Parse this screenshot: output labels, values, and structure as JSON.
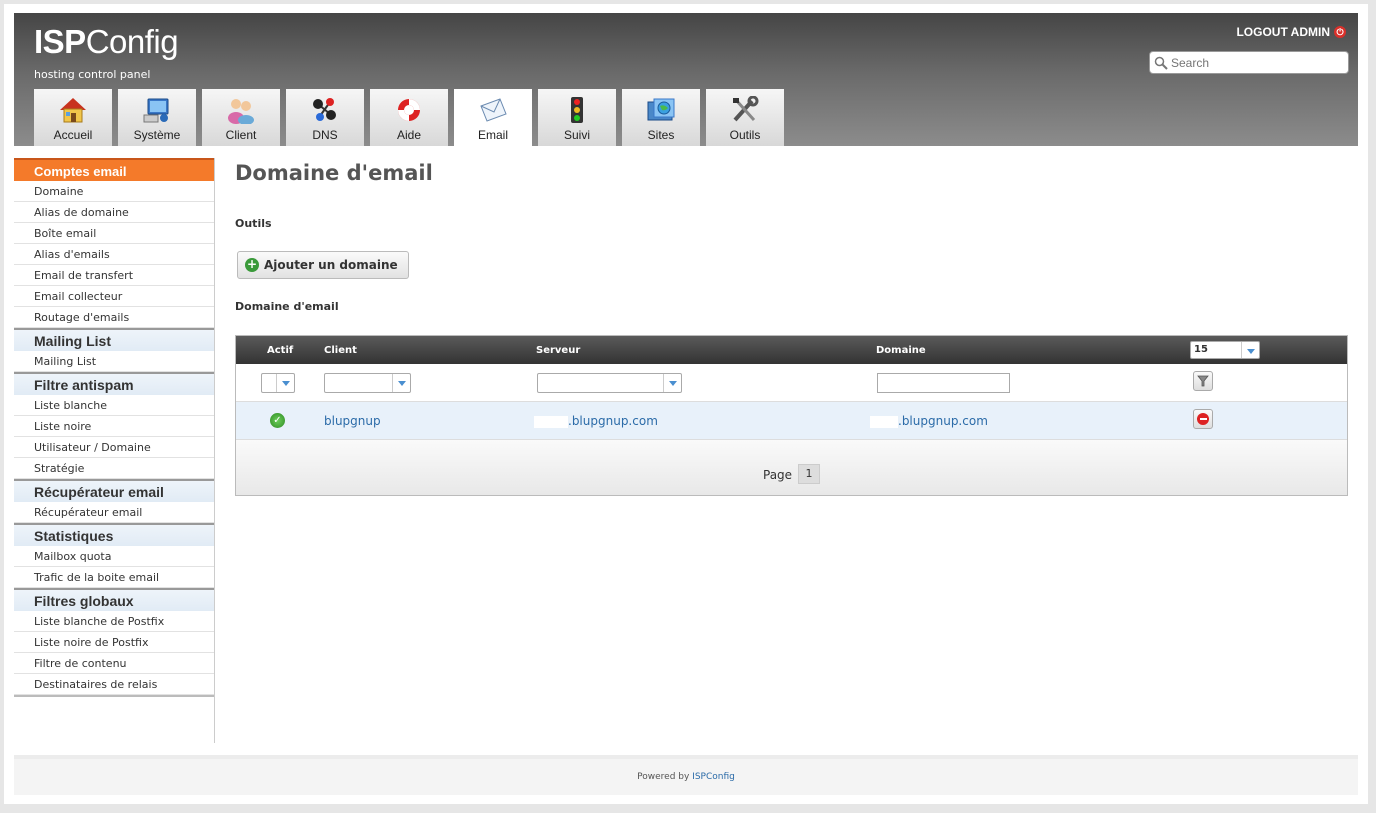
{
  "header": {
    "logo_bold": "ISP",
    "logo_rest": "Config",
    "subtitle": "hosting control panel",
    "logout": "LOGOUT ADMIN",
    "search_placeholder": "Search"
  },
  "tabs": [
    {
      "label": "Accueil",
      "icon": "house-icon"
    },
    {
      "label": "Système",
      "icon": "computer-icon"
    },
    {
      "label": "Client",
      "icon": "users-icon"
    },
    {
      "label": "DNS",
      "icon": "network-icon"
    },
    {
      "label": "Aide",
      "icon": "lifebuoy-icon"
    },
    {
      "label": "Email",
      "icon": "envelope-icon",
      "active": true
    },
    {
      "label": "Suivi",
      "icon": "traffic-light-icon"
    },
    {
      "label": "Sites",
      "icon": "globe-folder-icon"
    },
    {
      "label": "Outils",
      "icon": "tools-icon"
    }
  ],
  "sidebar": {
    "sections": [
      {
        "title": "Comptes email",
        "active": true,
        "items": [
          "Domaine",
          "Alias de domaine",
          "Boîte email",
          "Alias d'emails",
          "Email de transfert",
          "Email collecteur",
          "Routage d'emails"
        ]
      },
      {
        "title": "Mailing List",
        "items": [
          "Mailing List"
        ]
      },
      {
        "title": "Filtre antispam",
        "items": [
          "Liste blanche",
          "Liste noire",
          "Utilisateur / Domaine",
          "Stratégie"
        ]
      },
      {
        "title": "Récupérateur email",
        "items": [
          "Récupérateur email"
        ]
      },
      {
        "title": "Statistiques",
        "items": [
          "Mailbox quota",
          "Trafic de la boite email"
        ]
      },
      {
        "title": "Filtres globaux",
        "items": [
          "Liste blanche de Postfix",
          "Liste noire de Postfix",
          "Filtre de contenu",
          "Destinataires de relais"
        ]
      }
    ]
  },
  "main": {
    "title": "Domaine d'email",
    "tools_label": "Outils",
    "add_button": "Ajouter un domaine",
    "list_label": "Domaine d'email",
    "columns": {
      "actif": "Actif",
      "client": "Client",
      "serveur": "Serveur",
      "domaine": "Domaine"
    },
    "per_page": "15",
    "rows": [
      {
        "actif": true,
        "client": "blupgnup",
        "serveur": ".blupgnup.com",
        "domaine": ".blupgnup.com"
      }
    ],
    "pager_label": "Page",
    "page": "1"
  },
  "footer": {
    "powered": "Powered by ",
    "brand": "ISPConfig"
  }
}
